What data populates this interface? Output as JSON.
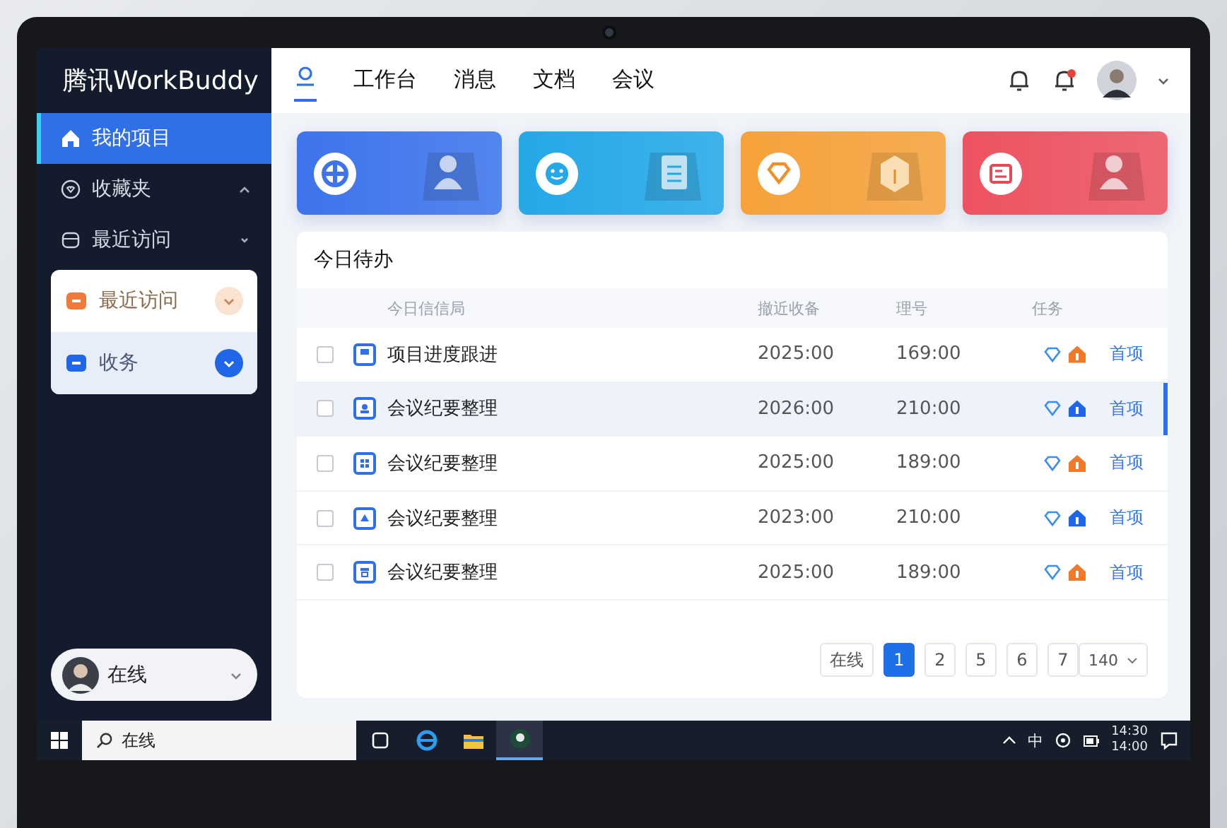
{
  "brand": "腾讯WorkBuddy",
  "top_tabs": [
    {
      "kind": "icon",
      "selected": true
    },
    {
      "kind": "text",
      "label": "工作台",
      "selected": false
    },
    {
      "kind": "text",
      "label": "消息",
      "selected": false
    },
    {
      "kind": "text",
      "label": "文档",
      "selected": false
    },
    {
      "kind": "text",
      "label": "会议",
      "selected": false
    }
  ],
  "bells": [
    {
      "badge": false
    },
    {
      "badge": true
    }
  ],
  "sidebar": {
    "items": [
      {
        "label": "我的项目",
        "selected": true
      },
      {
        "label": "收藏夹",
        "selected": false,
        "expanded": true
      },
      {
        "label": "最近访问",
        "selected": false,
        "expanded": false
      }
    ],
    "popup": [
      {
        "label": "最近访问",
        "color": "#f07a3c",
        "selected": false
      },
      {
        "label": "收务",
        "color": "#1f66e8",
        "selected": true
      }
    ],
    "status": "在线"
  },
  "cards": [
    {
      "color": "#3d74ec"
    },
    {
      "color": "#24a8e8"
    },
    {
      "color": "#f6a23a"
    },
    {
      "color": "#ee5260"
    }
  ],
  "todo": {
    "title": "今日待办",
    "columns": [
      "今日信信局",
      "撤近收备",
      "理号",
      "任务"
    ],
    "rows": [
      {
        "checked": false,
        "name": "项目进度跟进",
        "date": "2025:00",
        "number": "169:00",
        "color": "#f07a2a",
        "action": "首项",
        "selected": false
      },
      {
        "checked": false,
        "name": "会议纪要整理",
        "date": "2026:00",
        "number": "210:00",
        "color": "#1f66e8",
        "action": "首项",
        "selected": true
      },
      {
        "checked": false,
        "name": "会议纪要整理",
        "date": "2025:00",
        "number": "189:00",
        "color": "#f07a2a",
        "action": "首项",
        "selected": false
      },
      {
        "checked": false,
        "name": "会议纪要整理",
        "date": "2023:00",
        "number": "210:00",
        "color": "#1f66e8",
        "action": "首项",
        "selected": false
      },
      {
        "checked": false,
        "name": "会议纪要整理",
        "date": "2025:00",
        "number": "189:00",
        "color": "#f07a2a",
        "action": "首项",
        "selected": false
      }
    ],
    "pagination": {
      "prev": "在线",
      "pages": [
        {
          "label": "1",
          "selected": true
        },
        {
          "label": "2",
          "selected": false
        },
        {
          "label": "5",
          "selected": false
        },
        {
          "label": "6",
          "selected": false
        },
        {
          "label": "7",
          "selected": false
        }
      ],
      "page_size": "140"
    }
  },
  "taskbar": {
    "search": "在线",
    "ime": "中",
    "time": "14:30",
    "date": "14:00"
  }
}
